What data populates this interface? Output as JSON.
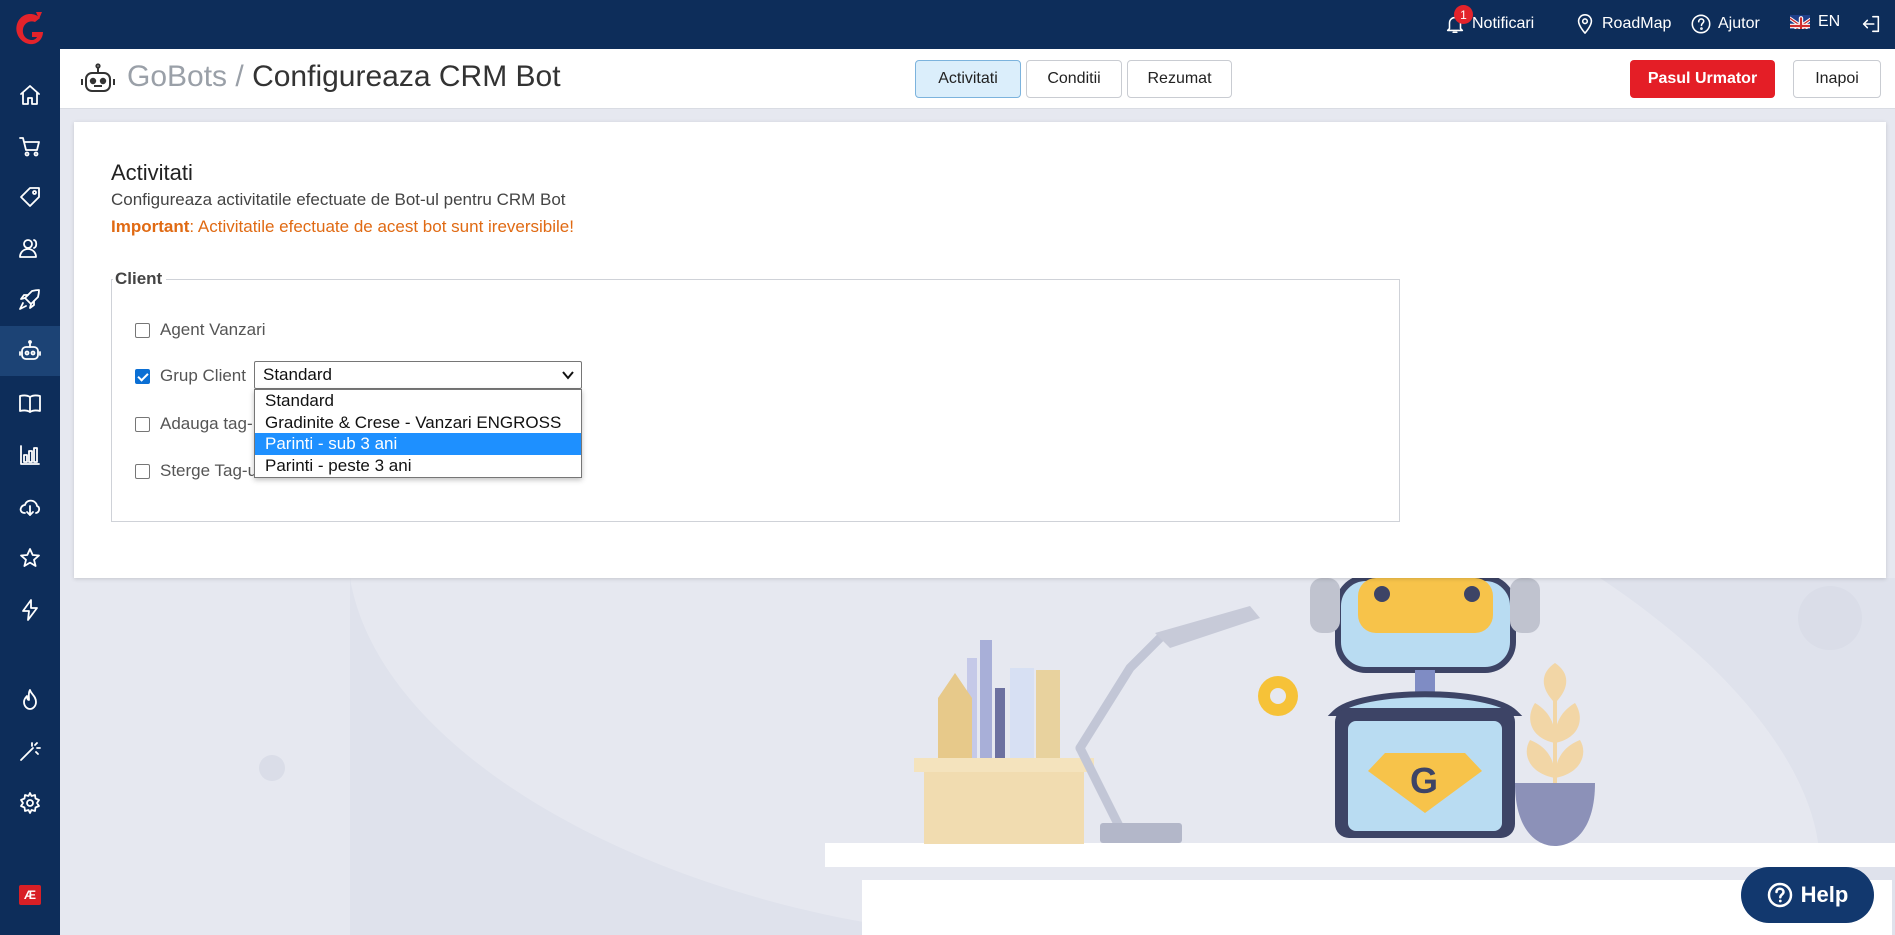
{
  "topbar": {
    "notifications_label": "Notificari",
    "notifications_count": "1",
    "roadmap_label": "RoadMap",
    "help_label": "Ajutor",
    "language_label": "EN"
  },
  "header": {
    "breadcrumb_parent": "GoBots",
    "separator": " / ",
    "title": "Configureaza CRM Bot",
    "tabs": [
      {
        "label": "Activitati",
        "active": true
      },
      {
        "label": "Conditii",
        "active": false
      },
      {
        "label": "Rezumat",
        "active": false
      }
    ],
    "next_button": "Pasul Urmator",
    "back_button": "Inapoi"
  },
  "card": {
    "title": "Activitati",
    "subtitle": "Configureaza activitatile efectuate de Bot-ul pentru CRM Bot",
    "warning_label": "Important",
    "warning_text": ": Activitatile efectuate de acest bot sunt ireversibile!",
    "section_label": "Client",
    "options": [
      {
        "label": "Agent Vanzari",
        "checked": false
      },
      {
        "label": "Grup Client",
        "checked": true
      },
      {
        "label": "Adauga tag-",
        "checked": false
      },
      {
        "label": "Sterge Tag-u",
        "checked": false
      }
    ],
    "group_select": {
      "value": "Standard",
      "options": [
        "Standard",
        "Gradinite & Crese - Vanzari ENGROSS",
        "Parinti - sub 3 ani",
        "Parinti - peste 3 ani"
      ],
      "highlighted_index": 2
    }
  },
  "help_button": "Help",
  "colors": {
    "navy": "#0d2d5a",
    "primary_red": "#e41e26",
    "warning_orange": "#e06a13",
    "tab_active_bg": "#dbeefb"
  }
}
